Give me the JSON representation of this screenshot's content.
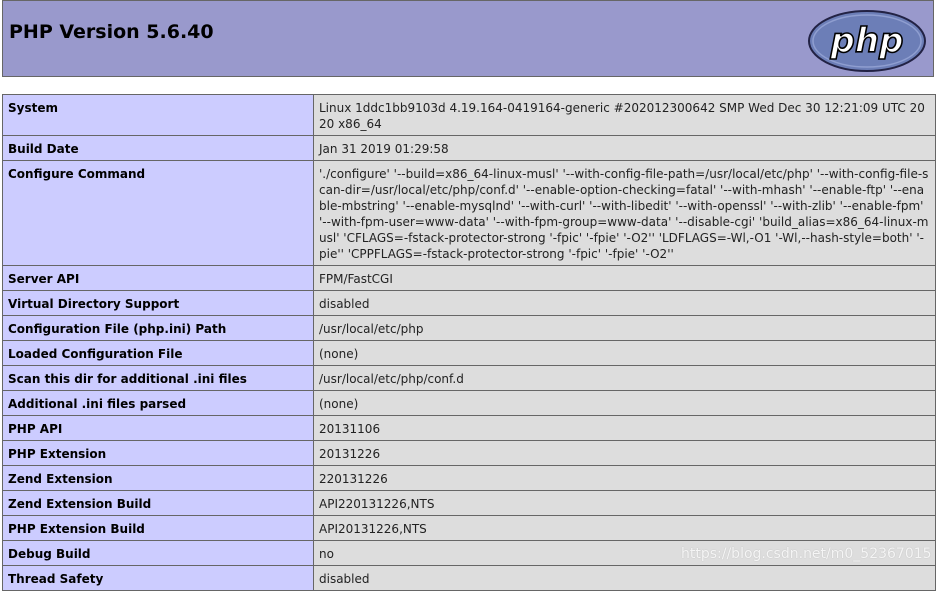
{
  "header": {
    "title": "PHP Version 5.6.40",
    "logo_text": "php"
  },
  "rows": [
    {
      "key": "System",
      "value": "Linux 1ddc1bb9103d 4.19.164-0419164-generic #202012300642 SMP Wed Dec 30 12:21:09 UTC 2020 x86_64"
    },
    {
      "key": "Build Date",
      "value": "Jan 31 2019 01:29:58"
    },
    {
      "key": "Configure Command",
      "value": "'./configure' '--build=x86_64-linux-musl' '--with-config-file-path=/usr/local/etc/php' '--with-config-file-scan-dir=/usr/local/etc/php/conf.d' '--enable-option-checking=fatal' '--with-mhash' '--enable-ftp' '--enable-mbstring' '--enable-mysqlnd' '--with-curl' '--with-libedit' '--with-openssl' '--with-zlib' '--enable-fpm' '--with-fpm-user=www-data' '--with-fpm-group=www-data' '--disable-cgi' 'build_alias=x86_64-linux-musl' 'CFLAGS=-fstack-protector-strong '-fpic' '-fpie' '-O2'' 'LDFLAGS=-Wl,-O1 '-Wl,--hash-style=both' '-pie'' 'CPPFLAGS=-fstack-protector-strong '-fpic' '-fpie' '-O2''"
    },
    {
      "key": "Server API",
      "value": "FPM/FastCGI"
    },
    {
      "key": "Virtual Directory Support",
      "value": "disabled"
    },
    {
      "key": "Configuration File (php.ini) Path",
      "value": "/usr/local/etc/php"
    },
    {
      "key": "Loaded Configuration File",
      "value": "(none)"
    },
    {
      "key": "Scan this dir for additional .ini files",
      "value": "/usr/local/etc/php/conf.d"
    },
    {
      "key": "Additional .ini files parsed",
      "value": "(none)"
    },
    {
      "key": "PHP API",
      "value": "20131106"
    },
    {
      "key": "PHP Extension",
      "value": "20131226"
    },
    {
      "key": "Zend Extension",
      "value": "220131226"
    },
    {
      "key": "Zend Extension Build",
      "value": "API220131226,NTS"
    },
    {
      "key": "PHP Extension Build",
      "value": "API20131226,NTS"
    },
    {
      "key": "Debug Build",
      "value": "no"
    },
    {
      "key": "Thread Safety",
      "value": "disabled"
    }
  ],
  "watermark": "https://blog.csdn.net/m0_52367015",
  "colors": {
    "header_bg": "#9999cc",
    "key_bg": "#ccccff",
    "value_bg": "#dddddd",
    "border": "#666666"
  }
}
